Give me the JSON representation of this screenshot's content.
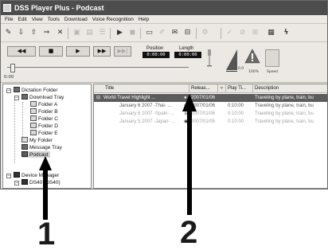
{
  "window": {
    "title": "DSS Player Plus - Podcast"
  },
  "menu": [
    "File",
    "Edit",
    "View",
    "Tools",
    "Download",
    "Voice Recognition",
    "Help"
  ],
  "toolbar": {
    "buttons": [
      {
        "icon": "record-icon",
        "glyph": "✎",
        "enabled": true
      },
      {
        "icon": "download-icon",
        "glyph": "⇩",
        "enabled": true
      },
      {
        "icon": "upload-icon",
        "glyph": "⇧",
        "enabled": true
      },
      {
        "icon": "send-icon",
        "glyph": "⇒",
        "enabled": true
      },
      {
        "icon": "delete-icon",
        "glyph": "✕",
        "enabled": true
      },
      {
        "icon": "properties-icon",
        "glyph": "▣",
        "enabled": false
      },
      {
        "icon": "export-icon",
        "glyph": "▤",
        "enabled": false
      },
      {
        "icon": "list-icon",
        "glyph": "☰",
        "enabled": false
      },
      {
        "icon": "play-file-icon",
        "glyph": "▶",
        "enabled": true
      },
      {
        "icon": "stop-file-icon",
        "glyph": "◼",
        "enabled": false
      },
      {
        "icon": "new-folder-icon",
        "glyph": "▭",
        "enabled": true
      },
      {
        "icon": "edit-icon",
        "glyph": "✐",
        "enabled": false
      },
      {
        "icon": "mail-icon",
        "glyph": "✉",
        "enabled": true
      },
      {
        "icon": "archive-icon",
        "glyph": "⊟",
        "enabled": true
      },
      {
        "icon": "options-icon",
        "glyph": "⚙",
        "enabled": false
      },
      {
        "icon": "check-icon",
        "glyph": "✓",
        "enabled": false
      },
      {
        "icon": "no-icon",
        "glyph": "⊘",
        "enabled": false
      },
      {
        "icon": "grid-icon",
        "glyph": "⊞",
        "enabled": false
      },
      {
        "icon": "transcribe-icon",
        "glyph": "▦",
        "enabled": true
      },
      {
        "icon": "voice-recognition-icon",
        "glyph": "ϟ",
        "enabled": true
      }
    ]
  },
  "transport": {
    "rewind_glyph": "◀◀",
    "stop_glyph": "■",
    "play_glyph": "▶",
    "fastforward_glyph": "▶▶",
    "skip_glyph": "▶▶|",
    "position_label": "Position",
    "position_value": "0:00:00",
    "length_label": "Length",
    "length_value": "0:00:00",
    "time_readout": "0:00",
    "volume_caption": "0.0",
    "warn_caption": "100%",
    "speed_caption": "Speed",
    "progress": 0.0
  },
  "tree": {
    "items": [
      {
        "label": "Dictation Folder",
        "icon": "dictation-folder-icon"
      },
      {
        "label": "Download Tray",
        "icon": "download-tray-icon"
      },
      {
        "label": "Folder A",
        "icon": "folder-icon"
      },
      {
        "label": "Folder B",
        "icon": "folder-icon"
      },
      {
        "label": "Folder C",
        "icon": "folder-icon"
      },
      {
        "label": "Folder D",
        "icon": "folder-icon"
      },
      {
        "label": "Folder E",
        "icon": "folder-icon"
      },
      {
        "label": "My Folder",
        "icon": "folder-icon"
      },
      {
        "label": "Message Tray",
        "icon": "message-tray-icon"
      },
      {
        "label": "Podcast",
        "icon": "podcast-icon"
      },
      {
        "label": "Device Manager",
        "icon": "device-manager-icon"
      },
      {
        "label": "DS40 (DS40)",
        "icon": "device-icon"
      }
    ]
  },
  "list": {
    "columns": [
      "Title",
      "Releas...",
      "Play Ti...",
      "Description"
    ],
    "rows": [
      {
        "title": "World Travel Highlight ...",
        "release": "2007/01/06",
        "play_time": "",
        "description": "Traveling by plane, train, bu",
        "selected": true
      },
      {
        "title": "January 6 2007 -Thai- ...",
        "release": "2007/01/06",
        "play_time": "0:10:00",
        "description": "Traveling by plane, train, bu",
        "selected": false
      },
      {
        "title": "January 6 2007 -Spain- ...",
        "release": "2007/01/06",
        "play_time": "0:10:00",
        "description": "Traveling by plane, train, bu",
        "selected": false
      },
      {
        "title": "January 5 2007 -Japan- ...",
        "release": "2007/01/05",
        "play_time": "0:10:00",
        "description": "Traveling by plane, train, bu",
        "selected": false
      }
    ]
  },
  "callouts": [
    {
      "number": "1"
    },
    {
      "number": "2"
    }
  ]
}
